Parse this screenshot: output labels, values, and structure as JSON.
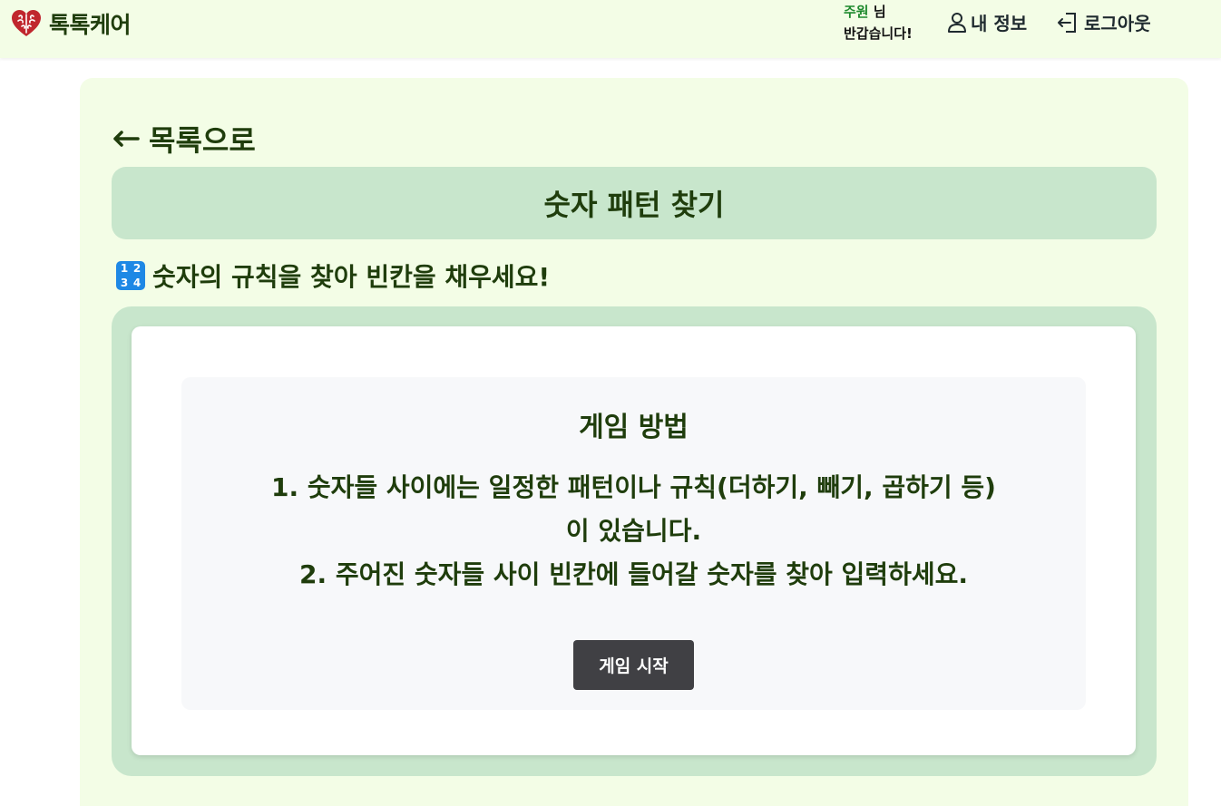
{
  "header": {
    "logo_text": "톡톡케어",
    "logo_icon": "brain-heart-icon",
    "greeting_user": "주원",
    "greeting_suffix": " 님",
    "greeting_line2": "반갑습니다!",
    "my_info_label": "내 정보",
    "my_info_icon": "user-icon",
    "logout_label": "로그아웃",
    "logout_icon": "logout-icon",
    "background": "#f3fde6"
  },
  "main": {
    "back_label": "목록으로",
    "back_icon": "arrow-left-icon",
    "title": "숫자 패턴 찾기",
    "subtitle": "숫자의 규칙을 찾아 빈칸을 채우세요!",
    "subtitle_icon": "input-numbers-icon",
    "howto": {
      "title": "게임 방법",
      "line1": "1. 숫자들 사이에는 일정한 패턴이나 규칙(더하기, 빼기, 곱하기 등)",
      "line1b": "이 있습니다.",
      "line2": "2. 주어진 숫자들 사이 빈칸에 들어갈 숫자를 찾아 입력하세요."
    },
    "start_button_label": "게임 시작"
  },
  "colors": {
    "accent_green": "#c8e6cc",
    "page_tint": "#f3fde6",
    "text_dark_green": "#1f3d0c",
    "button_dark": "#404044",
    "username_green": "#1f8a2e"
  }
}
